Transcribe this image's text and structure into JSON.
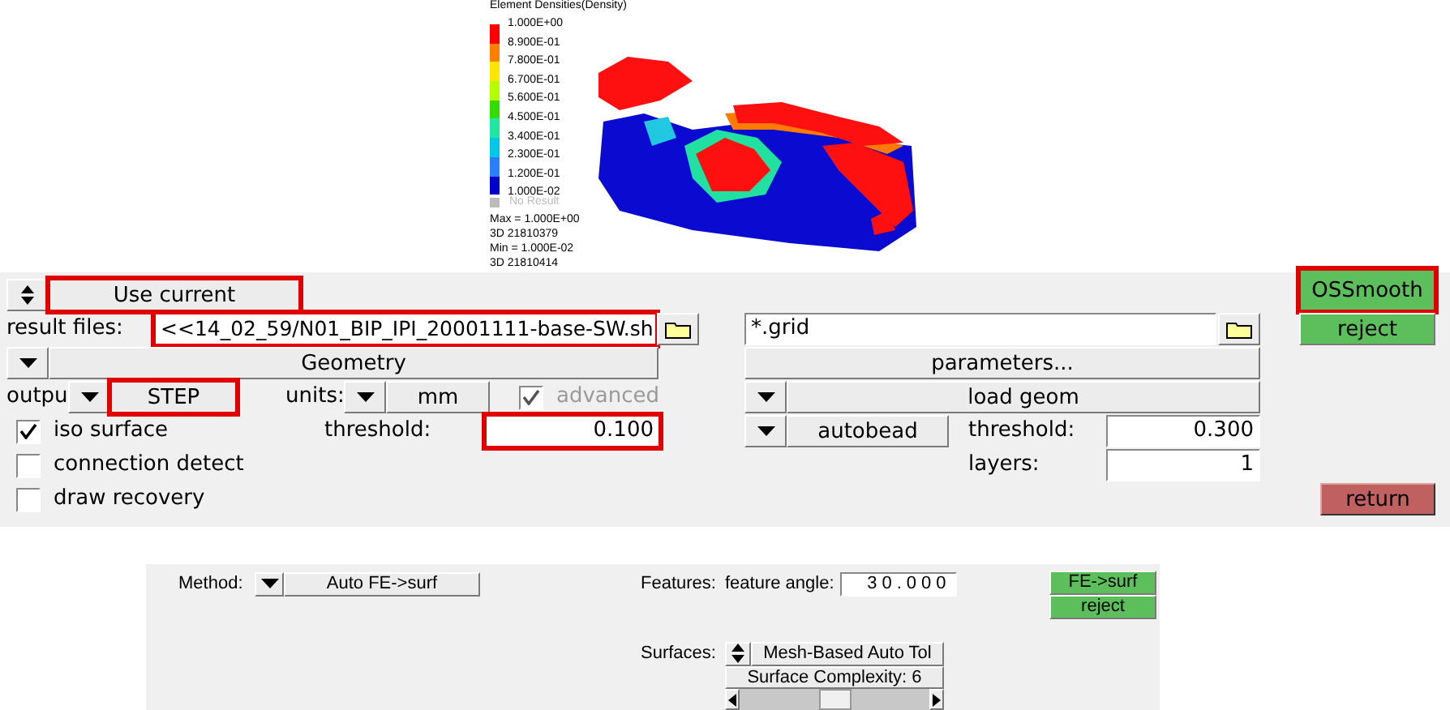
{
  "plot": {
    "title": "Element Densities(Density)",
    "labels": [
      "1.000E+00",
      "8.900E-01",
      "7.800E-01",
      "6.700E-01",
      "5.600E-01",
      "4.500E-01",
      "3.400E-01",
      "2.300E-01",
      "1.200E-01",
      "1.000E-02"
    ],
    "bands": [
      {
        "color": "#ff0000"
      },
      {
        "color": "#ff7f00"
      },
      {
        "color": "#ffe600"
      },
      {
        "color": "#b4ff00"
      },
      {
        "color": "#33dd00"
      },
      {
        "color": "#1fe6a0"
      },
      {
        "color": "#00c8e6"
      },
      {
        "color": "#2a7fff"
      },
      {
        "color": "#0000cc"
      }
    ],
    "no_result": "No Result",
    "stats": [
      "Max = 1.000E+00",
      "3D 21810379",
      "Min = 1.000E-02",
      "3D 21810414"
    ]
  },
  "panel": {
    "use_current": {
      "label": "Use current",
      "highlighted": true
    },
    "result_files": {
      "label": "result files:",
      "value": "<<14_02_59/N01_BIP_IPI_20001111-base-SW.sh",
      "highlighted": true
    },
    "geometry": "Geometry",
    "output": {
      "label": "outpu",
      "value": "STEP",
      "highlighted": true
    },
    "units": {
      "label": "units:",
      "value": "mm"
    },
    "advanced": {
      "label": "advanced",
      "checked": true,
      "disabled": true
    },
    "options": [
      {
        "label": "iso surface",
        "checked": true
      },
      {
        "label": "connection detect",
        "checked": false
      },
      {
        "label": "draw recovery",
        "checked": false
      }
    ],
    "threshold": {
      "label": "threshold:",
      "value": "0.100",
      "highlighted": true
    },
    "grid_file": "*.grid",
    "parameters": "parameters...",
    "load_geom": "load geom",
    "autobead": "autobead",
    "bead_threshold": {
      "label": "threshold:",
      "value": "0.300"
    },
    "layers": {
      "label": "layers:",
      "value": "1"
    },
    "actions": [
      {
        "label": "OSSmooth",
        "kind": "accept",
        "highlighted": true
      },
      {
        "label": "reject",
        "kind": "accept",
        "highlighted": false
      },
      {
        "label": "return",
        "kind": "return",
        "highlighted": false
      }
    ]
  },
  "fe_panel": {
    "method": {
      "label": "Method:",
      "value": "Auto FE->surf"
    },
    "features": {
      "label": "Features:",
      "angle_label": "feature angle:",
      "angle": "30.000"
    },
    "surfaces": {
      "label": "Surfaces:",
      "value": "Mesh-Based Auto Tol",
      "complexity": "Surface Complexity: 6",
      "level": 0.5
    },
    "buttons": [
      "FE->surf",
      "reject"
    ]
  }
}
